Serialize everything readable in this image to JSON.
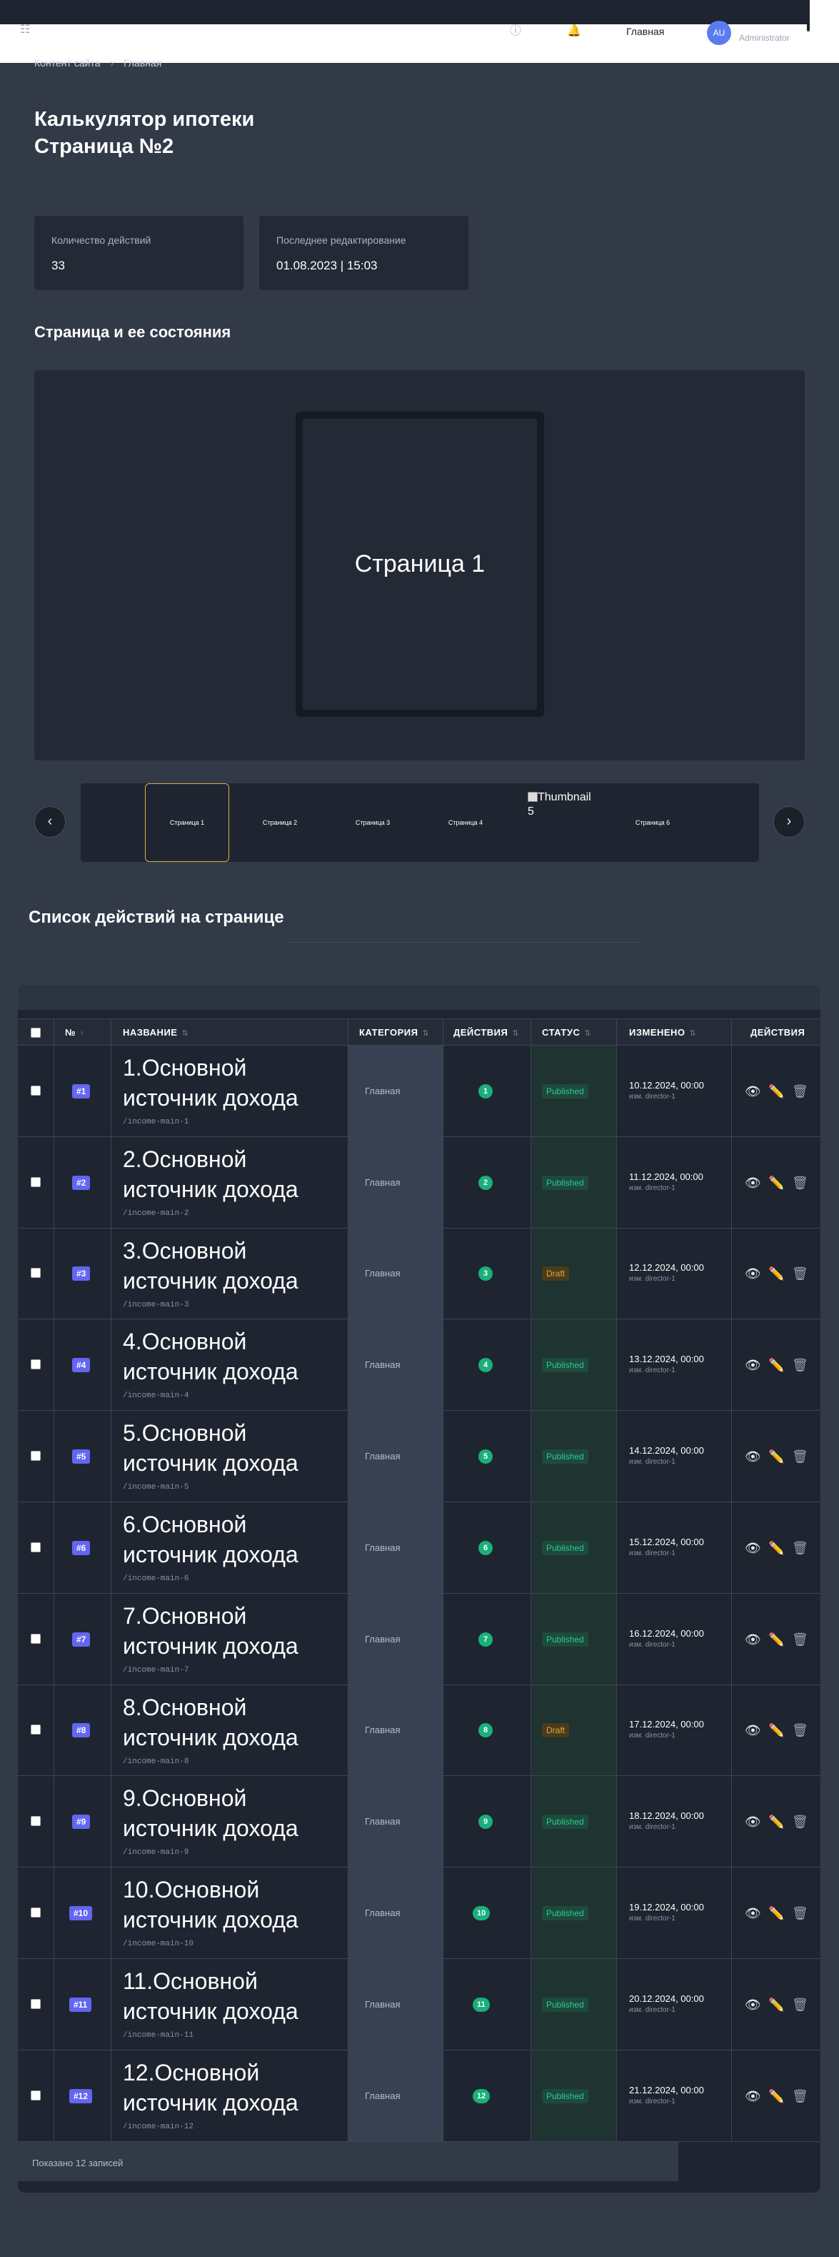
{
  "header": {
    "nav_link": "Главная",
    "avatar_initials": "AU",
    "user_role": "Administrator"
  },
  "breadcrumb": [
    "Контент сайта",
    "Главная"
  ],
  "page": {
    "title_line1": "Калькулятор ипотеки",
    "title_line2": "Страница №2"
  },
  "stats": [
    {
      "label": "Количество действий",
      "value": "33"
    },
    {
      "label": "Последнее редактирование",
      "value": "01.08.2023 | 15:03"
    }
  ],
  "states_section": {
    "title": "Страница и ее состояния",
    "preview_label": "Страница 1",
    "thumbnails": [
      "Страница 1",
      "Страница 2",
      "Страница 3",
      "Страница 4",
      "Страница 6"
    ],
    "broken_thumbnail_alt": "Thumbnail",
    "broken_thumbnail_num": "5"
  },
  "actions_section": {
    "title": "Список действий на странице"
  },
  "table": {
    "columns": [
      "№",
      "НАЗВАНИЕ",
      "КАТЕГОРИЯ",
      "ДЕЙСТВИЯ",
      "СТАТУС",
      "ИЗМЕНЕНО",
      "ДЕЙСТВИЯ"
    ],
    "rows": [
      {
        "num": "#1",
        "name": "1.Основной источник дохода",
        "slug": "/income-main-1",
        "category": "Главная",
        "actions": "1",
        "status": "Published",
        "changed": "10.12.2024, 00:00",
        "by": "изм. director-1"
      },
      {
        "num": "#2",
        "name": "2.Основной источник дохода",
        "slug": "/income-main-2",
        "category": "Главная",
        "actions": "2",
        "status": "Published",
        "changed": "11.12.2024, 00:00",
        "by": "изм. director-1"
      },
      {
        "num": "#3",
        "name": "3.Основной источник дохода",
        "slug": "/income-main-3",
        "category": "Главная",
        "actions": "3",
        "status": "Draft",
        "changed": "12.12.2024, 00:00",
        "by": "изм. director-1"
      },
      {
        "num": "#4",
        "name": "4.Основной источник дохода",
        "slug": "/income-main-4",
        "category": "Главная",
        "actions": "4",
        "status": "Published",
        "changed": "13.12.2024, 00:00",
        "by": "изм. director-1"
      },
      {
        "num": "#5",
        "name": "5.Основной источник дохода",
        "slug": "/income-main-5",
        "category": "Главная",
        "actions": "5",
        "status": "Published",
        "changed": "14.12.2024, 00:00",
        "by": "изм. director-1"
      },
      {
        "num": "#6",
        "name": "6.Основной источник дохода",
        "slug": "/income-main-6",
        "category": "Главная",
        "actions": "6",
        "status": "Published",
        "changed": "15.12.2024, 00:00",
        "by": "изм. director-1"
      },
      {
        "num": "#7",
        "name": "7.Основной источник дохода",
        "slug": "/income-main-7",
        "category": "Главная",
        "actions": "7",
        "status": "Published",
        "changed": "16.12.2024, 00:00",
        "by": "изм. director-1"
      },
      {
        "num": "#8",
        "name": "8.Основной источник дохода",
        "slug": "/income-main-8",
        "category": "Главная",
        "actions": "8",
        "status": "Draft",
        "changed": "17.12.2024, 00:00",
        "by": "изм. director-1"
      },
      {
        "num": "#9",
        "name": "9.Основной источник дохода",
        "slug": "/income-main-9",
        "category": "Главная",
        "actions": "9",
        "status": "Published",
        "changed": "18.12.2024, 00:00",
        "by": "изм. director-1"
      },
      {
        "num": "#10",
        "name": "10.Основной источник дохода",
        "slug": "/income-main-10",
        "category": "Главная",
        "actions": "10",
        "status": "Published",
        "changed": "19.12.2024, 00:00",
        "by": "изм. director-1"
      },
      {
        "num": "#11",
        "name": "11.Основной источник дохода",
        "slug": "/income-main-11",
        "category": "Главная",
        "actions": "11",
        "status": "Published",
        "changed": "20.12.2024, 00:00",
        "by": "изм. director-1"
      },
      {
        "num": "#12",
        "name": "12.Основной источник дохода",
        "slug": "/income-main-12",
        "category": "Главная",
        "actions": "12",
        "status": "Published",
        "changed": "21.12.2024, 00:00",
        "by": "изм. director-1"
      }
    ],
    "footer": "Показано 12 записей"
  },
  "icons": {
    "view": "eye-icon",
    "edit": "pencil-icon",
    "delete": "trash-icon"
  },
  "colors": {
    "accent": "#6366f1",
    "published": "#2fc98f",
    "draft": "#e2a93a",
    "actions_badge": "#19b07a"
  }
}
